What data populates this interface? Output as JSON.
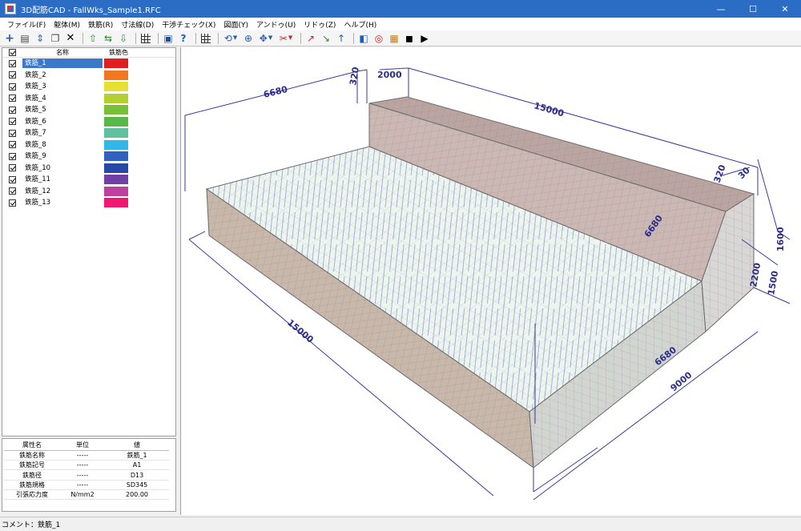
{
  "window": {
    "title": "3D配筋CAD - FallWks_Sample1.RFC",
    "minimize": "—",
    "maximize": "☐",
    "close": "✕"
  },
  "menu": [
    "ファイル(F)",
    "躯体(M)",
    "鉄筋(R)",
    "寸法線(D)",
    "干渉チェック(X)",
    "図面(Y)",
    "アンドゥ(U)",
    "リドゥ(Z)",
    "ヘルプ(H)"
  ],
  "toolbar": {
    "icons": [
      "add-icon",
      "open-icon",
      "fit-icon",
      "copy-icon",
      "delete-icon",
      "move-up-icon",
      "swap-icon",
      "move-down-icon",
      "grid-icon",
      "export-icon",
      "help-icon",
      "view-grid-icon",
      "rotate-icon",
      "zoom-icon",
      "pan-icon",
      "section-icon",
      "axis-x-icon",
      "axis-y-icon",
      "axis-z-icon",
      "display-icon",
      "target-icon",
      "palette-icon",
      "camera-icon",
      "record-icon"
    ]
  },
  "rebar_list": {
    "header": {
      "name": "名称",
      "color": "鉄筋色"
    },
    "items": [
      {
        "name": "鉄筋_1",
        "color": "#e02020",
        "checked": true,
        "selected": true
      },
      {
        "name": "鉄筋_2",
        "color": "#f07820",
        "checked": true
      },
      {
        "name": "鉄筋_3",
        "color": "#e8e030",
        "checked": true
      },
      {
        "name": "鉄筋_4",
        "color": "#b4d030",
        "checked": true
      },
      {
        "name": "鉄筋_5",
        "color": "#78c038",
        "checked": true
      },
      {
        "name": "鉄筋_6",
        "color": "#58b848",
        "checked": true
      },
      {
        "name": "鉄筋_7",
        "color": "#60c0a0",
        "checked": true
      },
      {
        "name": "鉄筋_8",
        "color": "#30b8e8",
        "checked": true
      },
      {
        "name": "鉄筋_9",
        "color": "#3060c0",
        "checked": true
      },
      {
        "name": "鉄筋_10",
        "color": "#2848a8",
        "checked": true
      },
      {
        "name": "鉄筋_11",
        "color": "#7040a8",
        "checked": true
      },
      {
        "name": "鉄筋_12",
        "color": "#c040a0",
        "checked": true
      },
      {
        "name": "鉄筋_13",
        "color": "#f01870",
        "checked": true
      }
    ]
  },
  "properties": {
    "headers": [
      "属性名",
      "単位",
      "値"
    ],
    "rows": [
      [
        "鉄筋名称",
        "-----",
        "鉄筋_1"
      ],
      [
        "鉄筋記号",
        "-----",
        "A1"
      ],
      [
        "鉄筋径",
        "-----",
        "D13"
      ],
      [
        "鉄筋規格",
        "-----",
        "SD345"
      ],
      [
        "引張応力度",
        "N/mm2",
        "200.00"
      ]
    ]
  },
  "view": {
    "dimensions": {
      "top_left": "6680",
      "top_320": "320",
      "top_2000": "2000",
      "top_long": "15000",
      "right_320": "320",
      "right_30": "30",
      "right_1600": "1600",
      "right_2200": "2200",
      "right_1500": "1500",
      "right_6680": "6680",
      "bottom_long": "15000",
      "bottom_6680": "6680",
      "bottom_9000": "9000"
    }
  },
  "status": {
    "text": "コメント：鉄筋_1"
  }
}
